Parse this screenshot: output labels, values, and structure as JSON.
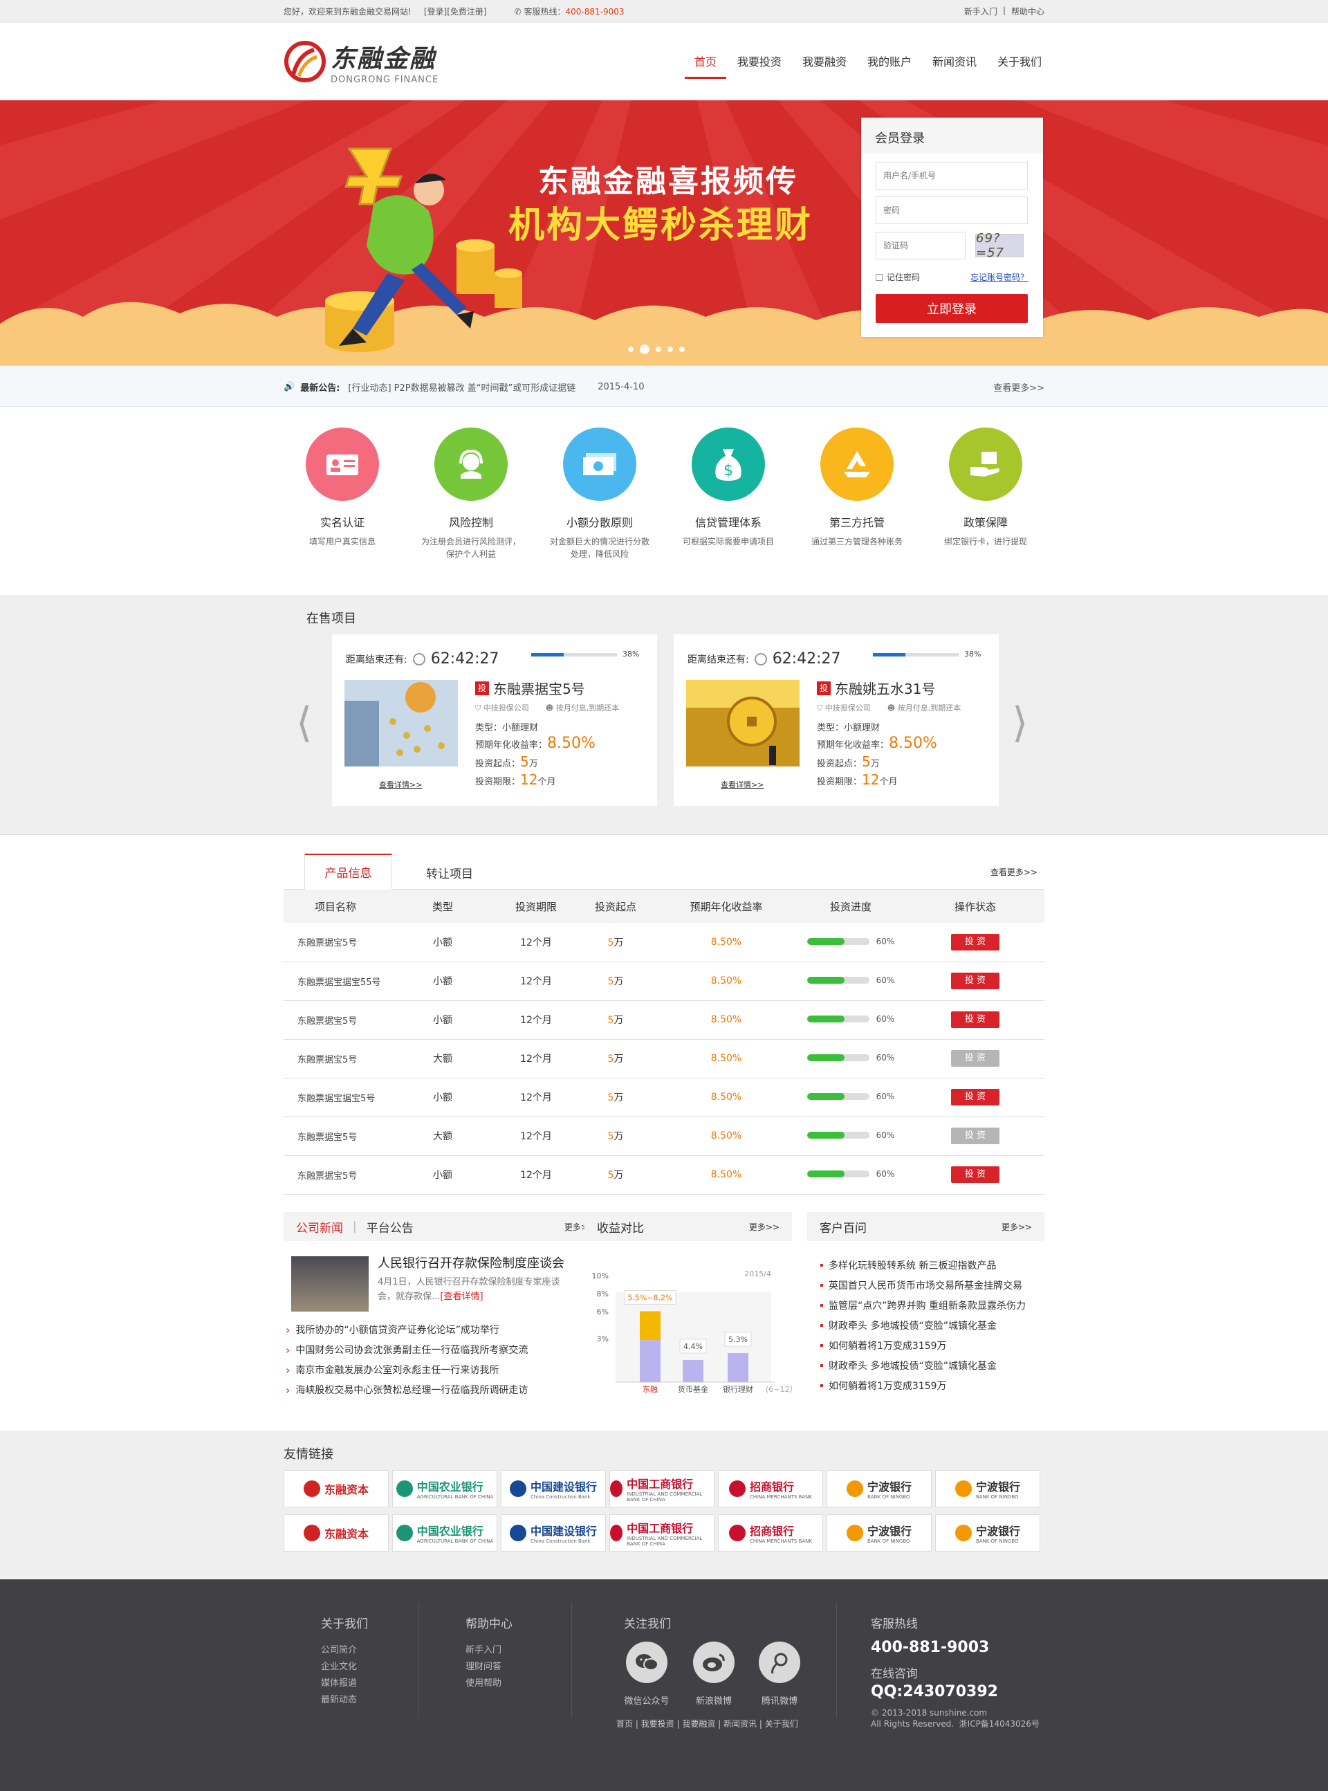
{
  "topbar": {
    "welcome": "您好，欢迎来到东融金融交易网站!",
    "login": "[登录]",
    "register": "[免费注册]",
    "hotline_label": "客服热线：",
    "hotline": "400-881-9003",
    "newbie": "新手入门",
    "sep": "|",
    "help": "帮助中心"
  },
  "logo": {
    "cn": "东融金融",
    "en": "DONGRONG FINANCE"
  },
  "nav": [
    "首页",
    "我要投资",
    "我要融资",
    "我的账户",
    "新闻资讯",
    "关于我们"
  ],
  "banner": {
    "line1": "东融金融喜报频传",
    "line2": "机构大鳄秒杀理财"
  },
  "login": {
    "title": "会员登录",
    "user_ph": "用户名/手机号",
    "pwd_ph": "密码",
    "captcha_ph": "验证码",
    "captcha": "69?=57",
    "remember": "记住密码",
    "forgot": "忘记账号密码？",
    "button": "立即登录"
  },
  "notice": {
    "label": "最新公告:",
    "text": "[行业动态] P2P数据易被篡改 盖“时间戳”或可形成证据链",
    "date": "2015-4-10",
    "more": "查看更多>>"
  },
  "features": [
    {
      "title": "实名认证",
      "desc": "填写用户真实信息",
      "color": "#f46b7e",
      "icon": "id-card-icon"
    },
    {
      "title": "风险控制",
      "desc": "为注册会员进行风险测评，保护个人利益",
      "color": "#76c63a",
      "icon": "headset-icon"
    },
    {
      "title": "小额分散原则",
      "desc": "对金额巨大的情况进行分散处理，降低风险",
      "color": "#4ab8ee",
      "icon": "money-icon"
    },
    {
      "title": "信贷管理体系",
      "desc": "可根据实际需要申请项目",
      "color": "#14b4a0",
      "icon": "money-bag-icon"
    },
    {
      "title": "第三方托管",
      "desc": "通过第三方管理各种账务",
      "color": "#f9b71b",
      "icon": "recycle-icon"
    },
    {
      "title": "政策保障",
      "desc": "绑定银行卡，进行提现",
      "color": "#a6c62c",
      "icon": "hand-box-icon"
    }
  ],
  "onsale": {
    "title": "在售项目",
    "cards": [
      {
        "countdown_label": "距离结束还有:",
        "time": "62:42:27",
        "progress": 0.38,
        "pct": "38%",
        "badge": "投",
        "name": "东融票据宝5号",
        "tag1": "中技担保公司",
        "tag2": "按月付息,到期还本",
        "type": "类型：小额理财",
        "rate_label": "预期年化收益率：",
        "rate": "8.50%",
        "min_label": "投资起点：",
        "min": "5",
        "min_unit": "万",
        "term_label": "投资期限：",
        "term": "12",
        "term_unit": "个月",
        "detail": "查看详情>>"
      },
      {
        "countdown_label": "距离结束还有:",
        "time": "62:42:27",
        "progress": 0.38,
        "pct": "38%",
        "badge": "投",
        "name": "东融姚五水31号",
        "tag1": "中技担保公司",
        "tag2": "按月付息,到期还本",
        "type": "类型：小额理财",
        "rate_label": "预期年化收益率：",
        "rate": "8.50%",
        "min_label": "投资起点：",
        "min": "5",
        "min_unit": "万",
        "term_label": "投资期限：",
        "term": "12",
        "term_unit": "个月",
        "detail": "查看详情>>"
      }
    ]
  },
  "products": {
    "tab1": "产品信息",
    "tab2": "转让项目",
    "more": "查看更多>>",
    "headers": [
      "项目名称",
      "类型",
      "投资期限",
      "投资起点",
      "预期年化收益率",
      "投资进度",
      "操作状态"
    ],
    "rows": [
      {
        "name": "东融票据宝5号",
        "type": "小额",
        "term": "12个月",
        "min": "5",
        "unit": "万",
        "rate": "8.50%",
        "progress": 0.6,
        "pct": "60%",
        "btn": "投 资",
        "active": true
      },
      {
        "name": "东融票据宝据宝55号",
        "type": "小额",
        "term": "12个月",
        "min": "5",
        "unit": "万",
        "rate": "8.50%",
        "progress": 0.6,
        "pct": "60%",
        "btn": "投 资",
        "active": true
      },
      {
        "name": "东融票据宝5号",
        "type": "小额",
        "term": "12个月",
        "min": "5",
        "unit": "万",
        "rate": "8.50%",
        "progress": 0.6,
        "pct": "60%",
        "btn": "投 资",
        "active": true
      },
      {
        "name": "东融票据宝5号",
        "type": "大额",
        "term": "12个月",
        "min": "5",
        "unit": "万",
        "rate": "8.50%",
        "progress": 0.6,
        "pct": "60%",
        "btn": "投 资",
        "active": false
      },
      {
        "name": "东融票据宝据宝5号",
        "type": "小额",
        "term": "12个月",
        "min": "5",
        "unit": "万",
        "rate": "8.50%",
        "progress": 0.6,
        "pct": "60%",
        "btn": "投 资",
        "active": true
      },
      {
        "name": "东融票据宝5号",
        "type": "大额",
        "term": "12个月",
        "min": "5",
        "unit": "万",
        "rate": "8.50%",
        "progress": 0.6,
        "pct": "60%",
        "btn": "投 资",
        "active": false
      },
      {
        "name": "东融票据宝5号",
        "type": "小额",
        "term": "12个月",
        "min": "5",
        "unit": "万",
        "rate": "8.50%",
        "progress": 0.6,
        "pct": "60%",
        "btn": "投 资",
        "active": true
      }
    ]
  },
  "news": {
    "tab1": "公司新闻",
    "sep": "|",
    "tab2": "平台公告",
    "more": "更多>>",
    "headline": "人民银行召开存款保险制度座谈会",
    "summary": "4月1日，人民银行召开存款保险制度专家座谈会，就存款保...",
    "summary_link": "[查看详情]",
    "items": [
      "我所协办的“小额信贷资产证券化论坛”成功举行",
      "中国财务公司协会沈张勇副主任一行莅临我所考察交流",
      "南京市金融发展办公室刘永彪主任一行来访我所",
      "海峡股权交易中心张赞松总经理一行莅临我所调研走访"
    ]
  },
  "compare": {
    "title": "收益对比",
    "more": "更多>>",
    "date": "2015/4",
    "range_label": "5.5%~8.2%"
  },
  "chart_data": {
    "type": "bar",
    "categories": [
      "东融",
      "货币基金",
      "银行理财"
    ],
    "category_note": "(6~12月)",
    "series": [
      {
        "values": [
          5.5,
          2.9,
          3.8
        ]
      },
      {
        "values": [
          2.7,
          null,
          null
        ]
      }
    ],
    "data_labels": [
      "5.5%~8.2%",
      "4.4%",
      "5.3%"
    ],
    "yticks": [
      "3%",
      "6%",
      "8%",
      "10%"
    ],
    "ylim": [
      0,
      10
    ]
  },
  "faq": {
    "title": "客户百问",
    "more": "更多>>",
    "items": [
      "多样化玩转股转系统 新三板迎指数产品",
      "英国首只人民币货币市场交易所基金挂牌交易",
      "监管层“点穴”跨界并购 重组新条款显露杀伤力",
      "财政牵头 多地城投债“变脸”城镇化基金",
      "如何躺着将1万变成3159万",
      "财政牵头 多地城投债“变脸”城镇化基金",
      "如何躺着将1万变成3159万"
    ]
  },
  "friend_links": {
    "title": "友情链接",
    "logos": [
      {
        "name": "东融资本",
        "sub": "",
        "color": "#d22323"
      },
      {
        "name": "中国农业银行",
        "sub": "AGRICULTURAL BANK OF CHINA",
        "color": "#1b9478"
      },
      {
        "name": "中国建设银行",
        "sub": "China Construction Bank",
        "color": "#164896"
      },
      {
        "name": "中国工商银行",
        "sub": "INDUSTRIAL AND COMMERCIAL BANK OF CHINA",
        "color": "#c8102e"
      },
      {
        "name": "招商银行",
        "sub": "CHINA MERCHANTS BANK",
        "color": "#c8102e"
      },
      {
        "name": "宁波银行",
        "sub": "BANK OF NINGBO",
        "color": "#f39800"
      },
      {
        "name": "宁波银行",
        "sub": "BANK OF NINGBO",
        "color": "#f39800"
      }
    ]
  },
  "footer": {
    "about": {
      "title": "关于我们",
      "items": [
        "公司简介",
        "企业文化",
        "媒体报道",
        "最新动态"
      ]
    },
    "help": {
      "title": "帮助中心",
      "items": [
        "新手入门",
        "理财问答",
        "使用帮助"
      ]
    },
    "follow": {
      "title": "关注我们",
      "items": [
        "微信公众号",
        "新浪微博",
        "腾讯微博"
      ],
      "links": "首页 | 我要投资 | 我要融资 | 新闻资讯 | 关于我们"
    },
    "service": {
      "title": "客服热线",
      "phone": "400-881-9003",
      "consult": "在线咨询",
      "qq": "QQ:243070392",
      "copyright": "© 2013-2018 sunshine.com",
      "rights": "All Rights Reserved.  浙ICP备14043026号"
    }
  }
}
